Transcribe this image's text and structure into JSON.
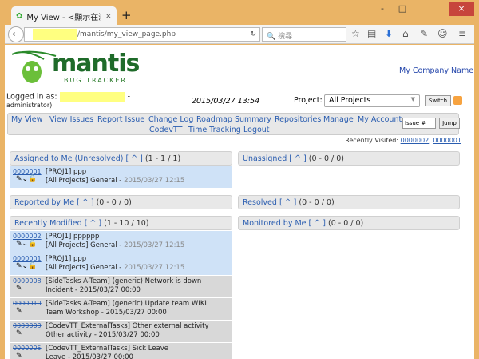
{
  "browser": {
    "tab_title": "My View - <顯示在瀏覽器...",
    "url": "/mantis/my_view_page.php",
    "search_placeholder": "搜尋",
    "window_controls": [
      "-",
      "□",
      "×"
    ]
  },
  "header": {
    "logo_text": "mantis",
    "logo_sub": "BUG TRACKER",
    "company": "My Company Name",
    "logged_in_label": "Logged in as:",
    "role": "administrator)",
    "datetime": "2015/03/27 13:54",
    "project_label": "Project:",
    "project_value": "All Projects",
    "switch_label": "Switch"
  },
  "menu": {
    "items": [
      "My View",
      "View Issues",
      "Report Issue",
      "Change Log",
      "Roadmap",
      "Summary",
      "Repositories",
      "Manage",
      "My Account",
      "CodevTT",
      "Time Tracking",
      "Logout"
    ],
    "issue_placeholder": "Issue #",
    "jump_label": "Jump"
  },
  "recent": {
    "label": "Recently Visited:",
    "items": [
      "0000002",
      "0000001"
    ]
  },
  "panels": {
    "assigned": {
      "title": "Assigned to Me (Unresolved)",
      "caret": "[ ^ ]",
      "count": "(1 - 1 / 1)"
    },
    "unassigned": {
      "title": "Unassigned",
      "caret": "[ ^ ]",
      "count": "(0 - 0 / 0)"
    },
    "reported": {
      "title": "Reported by Me",
      "caret": "[ ^ ]",
      "count": "(0 - 0 / 0)"
    },
    "resolved": {
      "title": "Resolved",
      "caret": "[ ^ ]",
      "count": "(0 - 0 / 0)"
    },
    "modified": {
      "title": "Recently Modified",
      "caret": "[ ^ ]",
      "count": "(1 - 10 / 10)"
    },
    "monitored": {
      "title": "Monitored by Me",
      "caret": "[ ^ ]",
      "count": "(0 - 0 / 0)"
    }
  },
  "assigned_rows": [
    {
      "id": "0000001",
      "summary": "[PROJ1] ppp",
      "category": "[All Projects] General - ",
      "date": "2015/03/27 12:15"
    }
  ],
  "modified_rows": [
    {
      "id": "0000002",
      "summary": "[PROJ1] pppppp",
      "category": "[All Projects] General - ",
      "date": "2015/03/27 12:15"
    },
    {
      "id": "0000001",
      "summary": "[PROJ1] ppp",
      "category": "[All Projects] General - ",
      "date": "2015/03/27 12:15"
    },
    {
      "id": "0000008",
      "summary": "[SideTasks A-Team] (generic) Network is down",
      "category": "Incident - ",
      "date": "2015/03/27 00:00"
    },
    {
      "id": "0000010",
      "summary": "[SideTasks A-Team] (generic) Update team WIKI",
      "category": "Team Workshop - ",
      "date": "2015/03/27 00:00"
    },
    {
      "id": "0000003",
      "summary": "[CodevTT_ExternalTasks] Other external activity",
      "category": "Other activity - ",
      "date": "2015/03/27 00:00"
    },
    {
      "id": "0000005",
      "summary": "[CodevTT_ExternalTasks] Sick Leave",
      "category": "Leave - ",
      "date": "2015/03/27 00:00"
    }
  ]
}
